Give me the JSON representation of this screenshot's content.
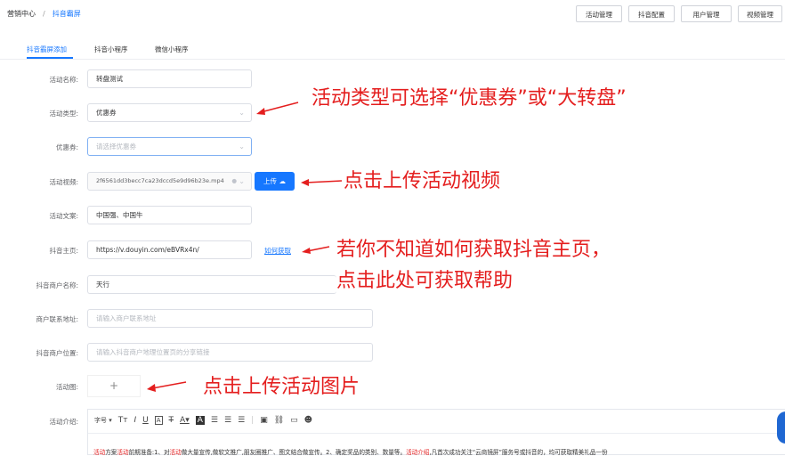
{
  "breadcrumb": {
    "home": "营销中心",
    "separator": "/",
    "current": "抖音霸屏"
  },
  "top_buttons": [
    "活动管理",
    "抖音配置",
    "用户管理",
    "视频管理"
  ],
  "tabs": [
    "抖音霸屏添加",
    "抖音小程序",
    "微信小程序"
  ],
  "form": {
    "activity_name": {
      "label": "活动名称:",
      "value": "转盘测试"
    },
    "activity_type": {
      "label": "活动类型:",
      "value": "优惠券"
    },
    "coupon": {
      "label": "优惠券:",
      "placeholder": "请选择优惠券"
    },
    "activity_video": {
      "label": "活动视频:",
      "value": "2f6561dd3becc7ca23dccd5e9d96b23e.mp4",
      "upload_label": "上传"
    },
    "activity_copy": {
      "label": "活动文案:",
      "value": "中国强、中国牛"
    },
    "douyin_homepage": {
      "label": "抖音主页:",
      "value": "https://v.douyin.com/eBVRx4n/",
      "help_link": "如何获取"
    },
    "merchant_name": {
      "label": "抖音商户名称:",
      "value": "天行"
    },
    "merchant_address": {
      "label": "商户联系地址:",
      "placeholder": "请输入商户联系地址"
    },
    "merchant_location": {
      "label": "抖音商户位置:",
      "placeholder": "请输入抖音商户地理位置页的分享链接"
    },
    "activity_image": {
      "label": "活动图:",
      "plus": "+"
    },
    "activity_intro": {
      "label": "活动介绍:"
    }
  },
  "annotations": {
    "type_note": "活动类型可选择“优惠券”或“大转盘”",
    "video_note": "点击上传活动视频",
    "homepage_note_1": "若你不知道如何获取抖音主页，",
    "homepage_note_2": "点击此处可获取帮助",
    "image_note": "点击上传活动图片"
  },
  "editor": {
    "font_size_label": "字号",
    "content_parts": [
      {
        "text": "活动",
        "highlight": true
      },
      {
        "text": "方案",
        "highlight": false
      },
      {
        "text": "活动",
        "highlight": true
      },
      {
        "text": "前期准备:1、对",
        "highlight": false
      },
      {
        "text": "活动",
        "highlight": true
      },
      {
        "text": "做大量宣传,做软文推广,朋友圈推广、图文结合做宣传。2、确定奖品的类别、数量等。",
        "highlight": false
      },
      {
        "text": "活动介绍",
        "highlight": true
      },
      {
        "text": ",凡首次成功关注“云商镜屏”服务号或抖音的，均可获取精美礼品一份",
        "highlight": false
      }
    ]
  },
  "colors": {
    "accent": "#1677ff",
    "annotation": "#e41e1e"
  }
}
